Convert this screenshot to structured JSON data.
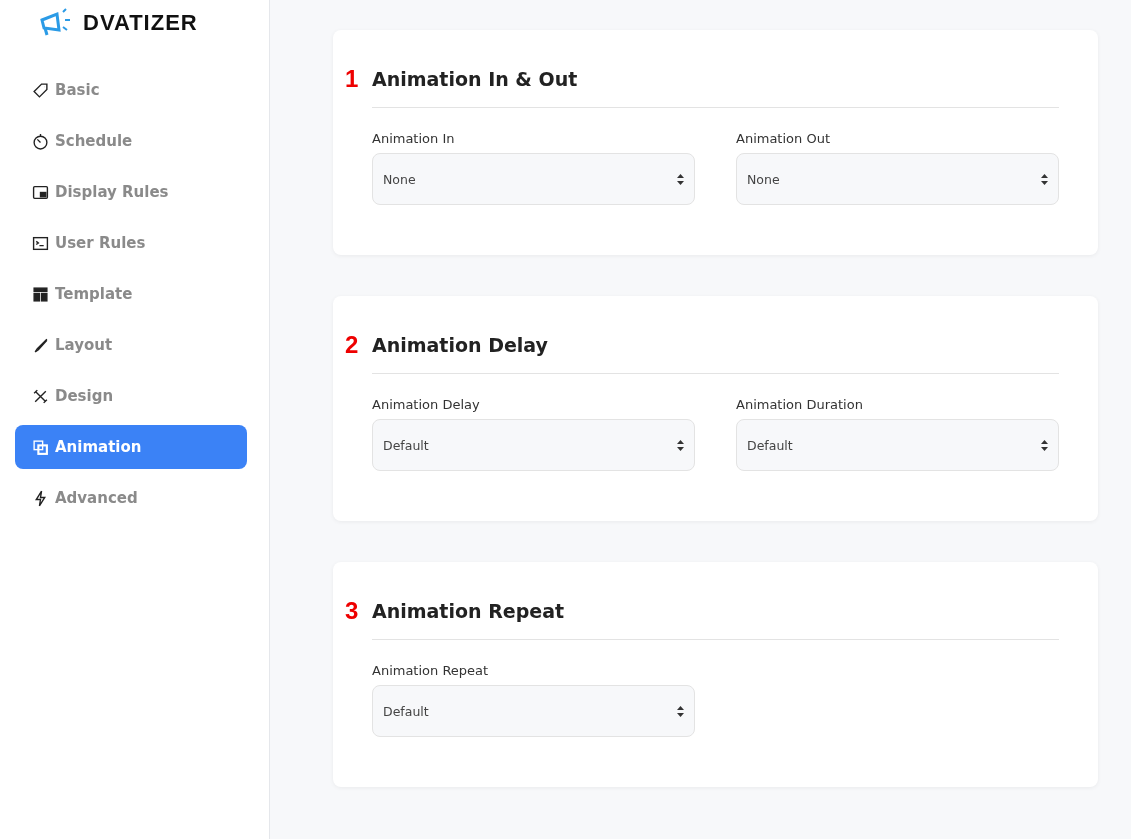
{
  "logo": {
    "text": "DVATIZER"
  },
  "sidebar": {
    "items": [
      {
        "label": "Basic",
        "selected": false
      },
      {
        "label": "Schedule",
        "selected": false
      },
      {
        "label": "Display Rules",
        "selected": false
      },
      {
        "label": "User Rules",
        "selected": false
      },
      {
        "label": "Template",
        "selected": false
      },
      {
        "label": "Layout",
        "selected": false
      },
      {
        "label": "Design",
        "selected": false
      },
      {
        "label": "Animation",
        "selected": true
      },
      {
        "label": "Advanced",
        "selected": false
      }
    ]
  },
  "sections": [
    {
      "marker": "1",
      "title": "Animation In & Out",
      "fields": [
        {
          "label": "Animation In",
          "value": "None"
        },
        {
          "label": "Animation Out",
          "value": "None"
        }
      ]
    },
    {
      "marker": "2",
      "title": "Animation Delay",
      "fields": [
        {
          "label": "Animation Delay",
          "value": "Default"
        },
        {
          "label": "Animation Duration",
          "value": "Default"
        }
      ]
    },
    {
      "marker": "3",
      "title": "Animation Repeat",
      "fields": [
        {
          "label": "Animation Repeat",
          "value": "Default"
        }
      ]
    }
  ]
}
